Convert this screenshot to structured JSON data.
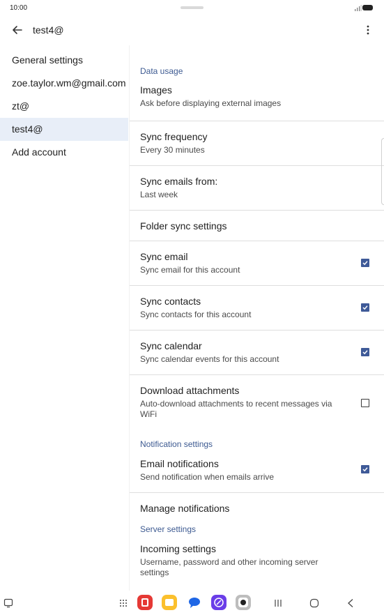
{
  "status": {
    "time": "10:00"
  },
  "app_bar": {
    "title": "test4@"
  },
  "sidebar": {
    "items": [
      {
        "label": "General settings",
        "active": false
      },
      {
        "label": "zoe.taylor.wm@gmail.com",
        "active": false
      },
      {
        "label": "zt@",
        "active": false
      },
      {
        "label": "test4@",
        "active": true
      },
      {
        "label": "Add account",
        "active": false
      }
    ]
  },
  "settings": {
    "data_usage_header": "Data usage",
    "images": {
      "title": "Images",
      "subtitle": "Ask before displaying external images"
    },
    "sync_frequency": {
      "title": "Sync frequency",
      "subtitle": "Every 30 minutes"
    },
    "sync_emails_from": {
      "title": "Sync emails from:",
      "subtitle": "Last week"
    },
    "folder_sync": {
      "title": "Folder sync settings"
    },
    "sync_email": {
      "title": "Sync email",
      "subtitle": "Sync email for this account",
      "checked": true
    },
    "sync_contacts": {
      "title": "Sync contacts",
      "subtitle": "Sync contacts for this account",
      "checked": true
    },
    "sync_calendar": {
      "title": "Sync calendar",
      "subtitle": "Sync calendar events for this account",
      "checked": true
    },
    "download_attachments": {
      "title": "Download attachments",
      "subtitle": "Auto-download attachments to recent messages via WiFi",
      "checked": false
    },
    "notification_header": "Notification settings",
    "email_notifications": {
      "title": "Email notifications",
      "subtitle": "Send notification when emails arrive",
      "checked": true
    },
    "manage_notifications": {
      "title": "Manage notifications"
    },
    "server_header": "Server settings",
    "incoming": {
      "title": "Incoming settings",
      "subtitle": "Username, password and other incoming server settings"
    }
  },
  "colors": {
    "accent": "#3f5a98",
    "section_header": "#3d5a91",
    "active_row": "#e8eef8"
  },
  "nav_bar": {
    "icons": [
      "taskbar-icon",
      "apps-grid-icon",
      "app-red-icon",
      "app-yellow-icon",
      "app-chat-icon",
      "app-purple-icon",
      "app-camera-icon",
      "recents-icon",
      "home-icon",
      "back-nav-icon"
    ]
  }
}
